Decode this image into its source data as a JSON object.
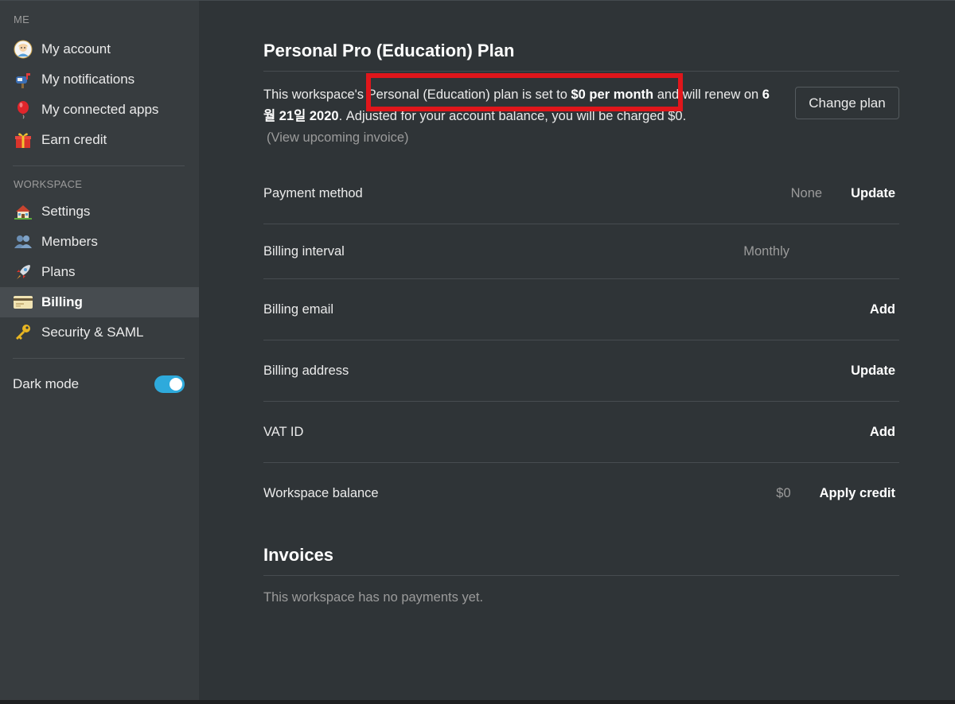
{
  "sidebar": {
    "me_label": "ME",
    "me_items": [
      {
        "label": "My account",
        "icon": "avatar-icon"
      },
      {
        "label": "My notifications",
        "icon": "mailbox-icon"
      },
      {
        "label": "My connected apps",
        "icon": "balloon-icon"
      },
      {
        "label": "Earn credit",
        "icon": "gift-icon"
      }
    ],
    "workspace_label": "WORKSPACE",
    "workspace_items": [
      {
        "label": "Settings",
        "icon": "house-icon"
      },
      {
        "label": "Members",
        "icon": "people-icon"
      },
      {
        "label": "Plans",
        "icon": "rocket-icon"
      },
      {
        "label": "Billing",
        "icon": "credit-card-icon",
        "active": true
      },
      {
        "label": "Security & SAML",
        "icon": "key-icon"
      }
    ],
    "dark_mode_label": "Dark mode",
    "dark_mode_on": true
  },
  "plan": {
    "title": "Personal Pro (Education) Plan",
    "text_1": "This workspace's ",
    "text_2": "Personal (Education) plan is set to ",
    "price": "$0 per month",
    "text_3": " and will renew on ",
    "renew_date": "6월 21일 2020",
    "text_4": ". Adjusted for your account balance, you will be charged $0.",
    "invoice_link": "(View upcoming invoice)",
    "change_plan_label": "Change plan"
  },
  "billing_rows": [
    {
      "label": "Payment method",
      "value": "None",
      "action": "Update"
    },
    {
      "label": "Billing interval",
      "value": "Monthly",
      "action": ""
    },
    {
      "label": "Billing email",
      "value": "",
      "action": "Add"
    },
    {
      "label": "Billing address",
      "value": "",
      "action": "Update"
    },
    {
      "label": "VAT ID",
      "value": "",
      "action": "Add"
    },
    {
      "label": "Workspace balance",
      "value": "$0",
      "action": "Apply credit"
    }
  ],
  "invoices": {
    "title": "Invoices",
    "empty_text": "This workspace has no payments yet."
  },
  "colors": {
    "background": "#2f3437",
    "sidebar": "#373c3f",
    "highlight": "#e0161b",
    "toggle_on": "#2eaadc"
  }
}
